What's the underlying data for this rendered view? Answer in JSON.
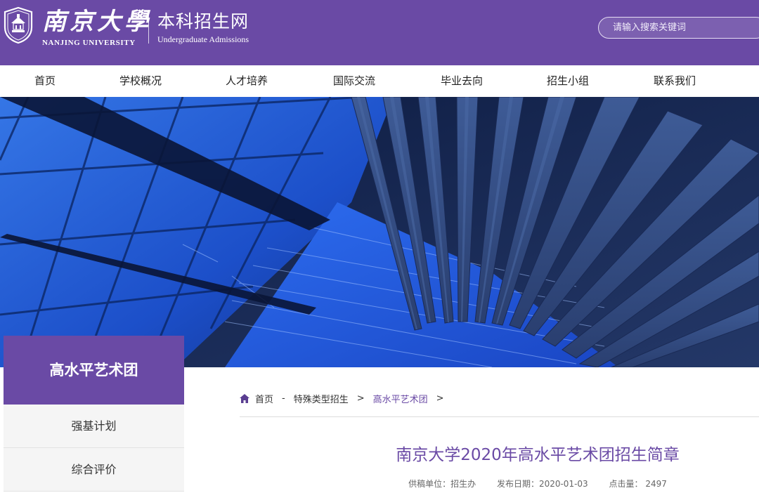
{
  "header": {
    "university_cn": "南京大學",
    "university_en": "NANJING UNIVERSITY",
    "site_cn": "本科招生网",
    "site_en": "Undergraduate Admissions",
    "search_placeholder": "请输入搜索关键词"
  },
  "nav": {
    "items": [
      {
        "label": "首页"
      },
      {
        "label": "学校概况"
      },
      {
        "label": "人才培养"
      },
      {
        "label": "国际交流"
      },
      {
        "label": "毕业去向"
      },
      {
        "label": "招生小组"
      },
      {
        "label": "联系我们"
      }
    ]
  },
  "sidebar": {
    "title": "高水平艺术团",
    "items": [
      {
        "label": "强基计划"
      },
      {
        "label": "综合评价"
      }
    ]
  },
  "breadcrumb": {
    "home": "首页",
    "dash": "-",
    "section": "特殊类型招生",
    "sep": ">",
    "current": "高水平艺术团",
    "trail": ">"
  },
  "article": {
    "title": "南京大学2020年高水平艺术团招生简章",
    "source": "供稿单位：招生办",
    "date": "发布日期：2020-01-03",
    "views_label": "点击量：",
    "views": "2497"
  },
  "colors": {
    "brand_purple": "#6a4aa5",
    "banner_blue": "#1f4fd1"
  }
}
